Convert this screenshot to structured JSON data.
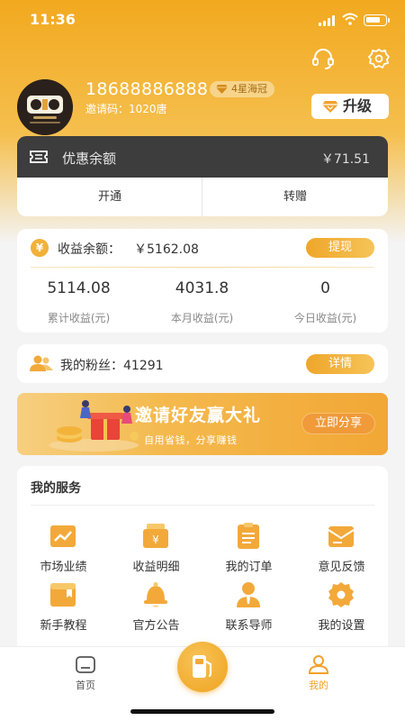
{
  "status_bar": {
    "time": "11:36"
  },
  "colors": {
    "accent": "#f2a91f",
    "dark_card": "#3d3d3d",
    "background": "#f4f4f4"
  },
  "header": {
    "support_icon": "headset-icon",
    "settings_icon": "gear-icon"
  },
  "profile": {
    "phone": "18688886888",
    "level": "4星海冠",
    "invite_code": "邀请码：1020唐",
    "upgrade_label": "升级"
  },
  "coupon": {
    "label": "优惠余额",
    "value": "￥71.51",
    "actions": [
      "开通",
      "转赠"
    ]
  },
  "earnings": {
    "label": "收益余额：",
    "value": "￥5162.08",
    "withdraw_label": "提现",
    "stats": [
      {
        "value": "5114.08",
        "label": "累计收益(元)"
      },
      {
        "value": "4031.8",
        "label": "本月收益(元)"
      },
      {
        "value": "0",
        "label": "今日收益(元)"
      }
    ]
  },
  "fans": {
    "label": "我的粉丝：",
    "count": "41291",
    "detail_label": "详情"
  },
  "banner": {
    "title": "邀请好友赢大礼",
    "subtitle": "自用省钱，分享赚钱",
    "button": "立即分享"
  },
  "services": {
    "title": "我的服务",
    "items": [
      {
        "label": "市场业绩",
        "icon": "chart-icon"
      },
      {
        "label": "收益明细",
        "icon": "wallet-icon"
      },
      {
        "label": "我的订单",
        "icon": "order-icon"
      },
      {
        "label": "意见反馈",
        "icon": "feedback-icon"
      },
      {
        "label": "新手教程",
        "icon": "tutorial-icon"
      },
      {
        "label": "官方公告",
        "icon": "announcement-icon"
      },
      {
        "label": "联系导师",
        "icon": "mentor-icon"
      },
      {
        "label": "我的设置",
        "icon": "settings-icon"
      }
    ]
  },
  "tabbar": {
    "home": "首页",
    "center_icon": "fuel-pump-icon",
    "mine": "我的"
  }
}
